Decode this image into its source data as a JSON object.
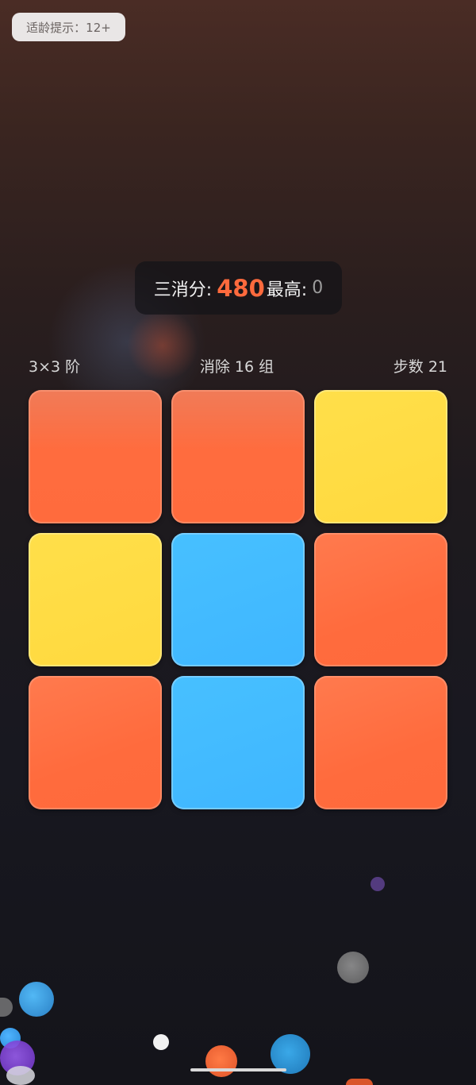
{
  "age_badge": {
    "label": "适龄提示：12+"
  },
  "score": {
    "label": "三消分:",
    "value": "480",
    "best_label": "最高:",
    "best_value": "0",
    "value_color": "#ff6a3d"
  },
  "info": {
    "board_size": "3×3 阶",
    "cleared": "消除 16 组",
    "steps": "步数 21"
  },
  "board": {
    "rows": 3,
    "cols": 3,
    "tiles": [
      [
        "orange",
        "orange",
        "yellow"
      ],
      [
        "yellow",
        "blue",
        "orange"
      ],
      [
        "orange",
        "blue",
        "orange"
      ]
    ],
    "colors": {
      "orange": "#ff6b3d",
      "yellow": "#ffd93e",
      "blue": "#3fb6ff"
    }
  }
}
